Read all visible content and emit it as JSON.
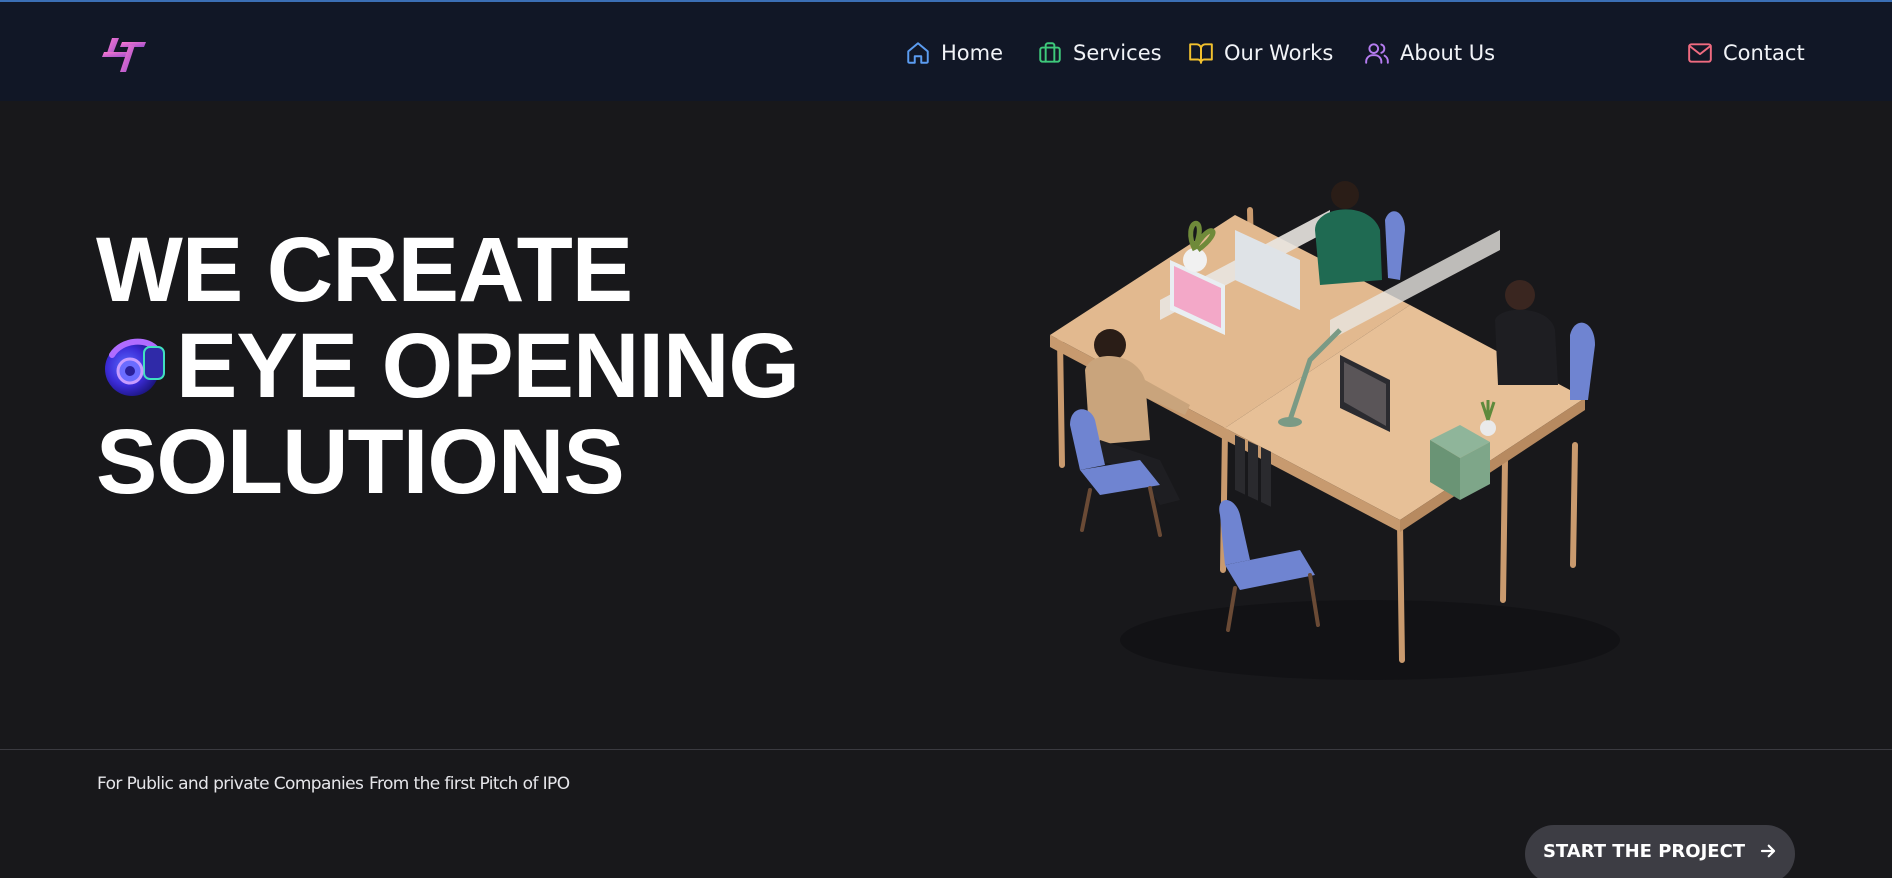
{
  "nav": {
    "items": [
      {
        "label": "Home",
        "icon": "home-icon",
        "color": "#5b9cf0"
      },
      {
        "label": "Services",
        "icon": "briefcase-icon",
        "color": "#3ec97b"
      },
      {
        "label": "Our Works",
        "icon": "book-icon",
        "color": "#f2c12e"
      },
      {
        "label": "About Us",
        "icon": "users-icon",
        "color": "#b57cf0"
      }
    ],
    "contact": {
      "label": "Contact",
      "icon": "mail-icon",
      "color": "#f06b80"
    }
  },
  "hero": {
    "line1": "WE CREATE",
    "line2": "EYE OPENING",
    "line3": "SOLUTIONS"
  },
  "taglines": [
    "For Public and private Companies",
    "From the first Pitch of IPO"
  ],
  "cta": {
    "label": "START THE PROJECT",
    "icon": "arrow-right-icon"
  },
  "colors": {
    "background": "#18181b",
    "navbar": "#111726",
    "cta": "#3d3d44"
  }
}
